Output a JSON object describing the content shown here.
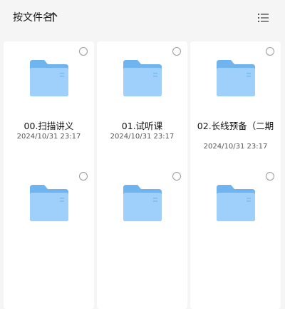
{
  "toolbar": {
    "sort_label": "按文件名",
    "sort_direction_icon": "arrow-up-icon",
    "view_toggle_icon": "list-view-icon"
  },
  "colors": {
    "folder_back": "#6fb4ee",
    "folder_front": "#9fd0fb",
    "background": "#f5f5f5"
  },
  "files": [
    {
      "name": "00.扫描讲义",
      "date": "2024/10/31 23:17"
    },
    {
      "name": "01.试听课",
      "date": "2024/10/31 23:17"
    },
    {
      "name": "02.长线预备（二期",
      "date": "2024/10/31 23:17"
    },
    {
      "name": "",
      "date": ""
    },
    {
      "name": "",
      "date": ""
    },
    {
      "name": "",
      "date": ""
    }
  ]
}
